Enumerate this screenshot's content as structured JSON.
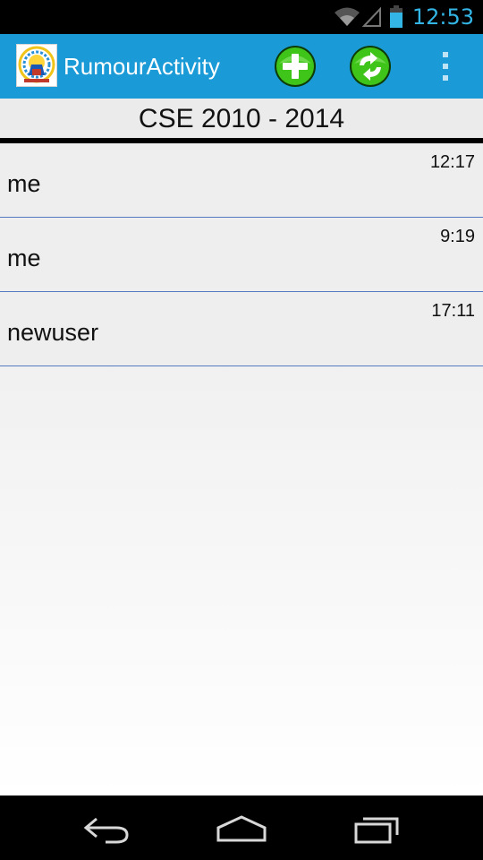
{
  "status_bar": {
    "time": "12:53",
    "icons": [
      "wifi-icon",
      "signal-icon",
      "battery-icon"
    ]
  },
  "action_bar": {
    "title": "RumourActivity",
    "app_icon": "app-logo-icon",
    "actions": [
      "add-icon",
      "refresh-icon",
      "overflow-menu-icon"
    ],
    "color": "#1a9ad6"
  },
  "group": {
    "title": "CSE 2010 - 2014"
  },
  "list": {
    "items": [
      {
        "name": "me",
        "time": "12:17"
      },
      {
        "name": "me",
        "time": "9:19"
      },
      {
        "name": "newuser",
        "time": "17:11"
      }
    ]
  },
  "nav_bar": {
    "buttons": [
      "back-icon",
      "home-icon",
      "recent-apps-icon"
    ]
  },
  "colors": {
    "accent": "#33b5e5",
    "action_bar": "#1a9ad6",
    "list_divider": "#5779c1",
    "add_button": "#3fc41a"
  }
}
